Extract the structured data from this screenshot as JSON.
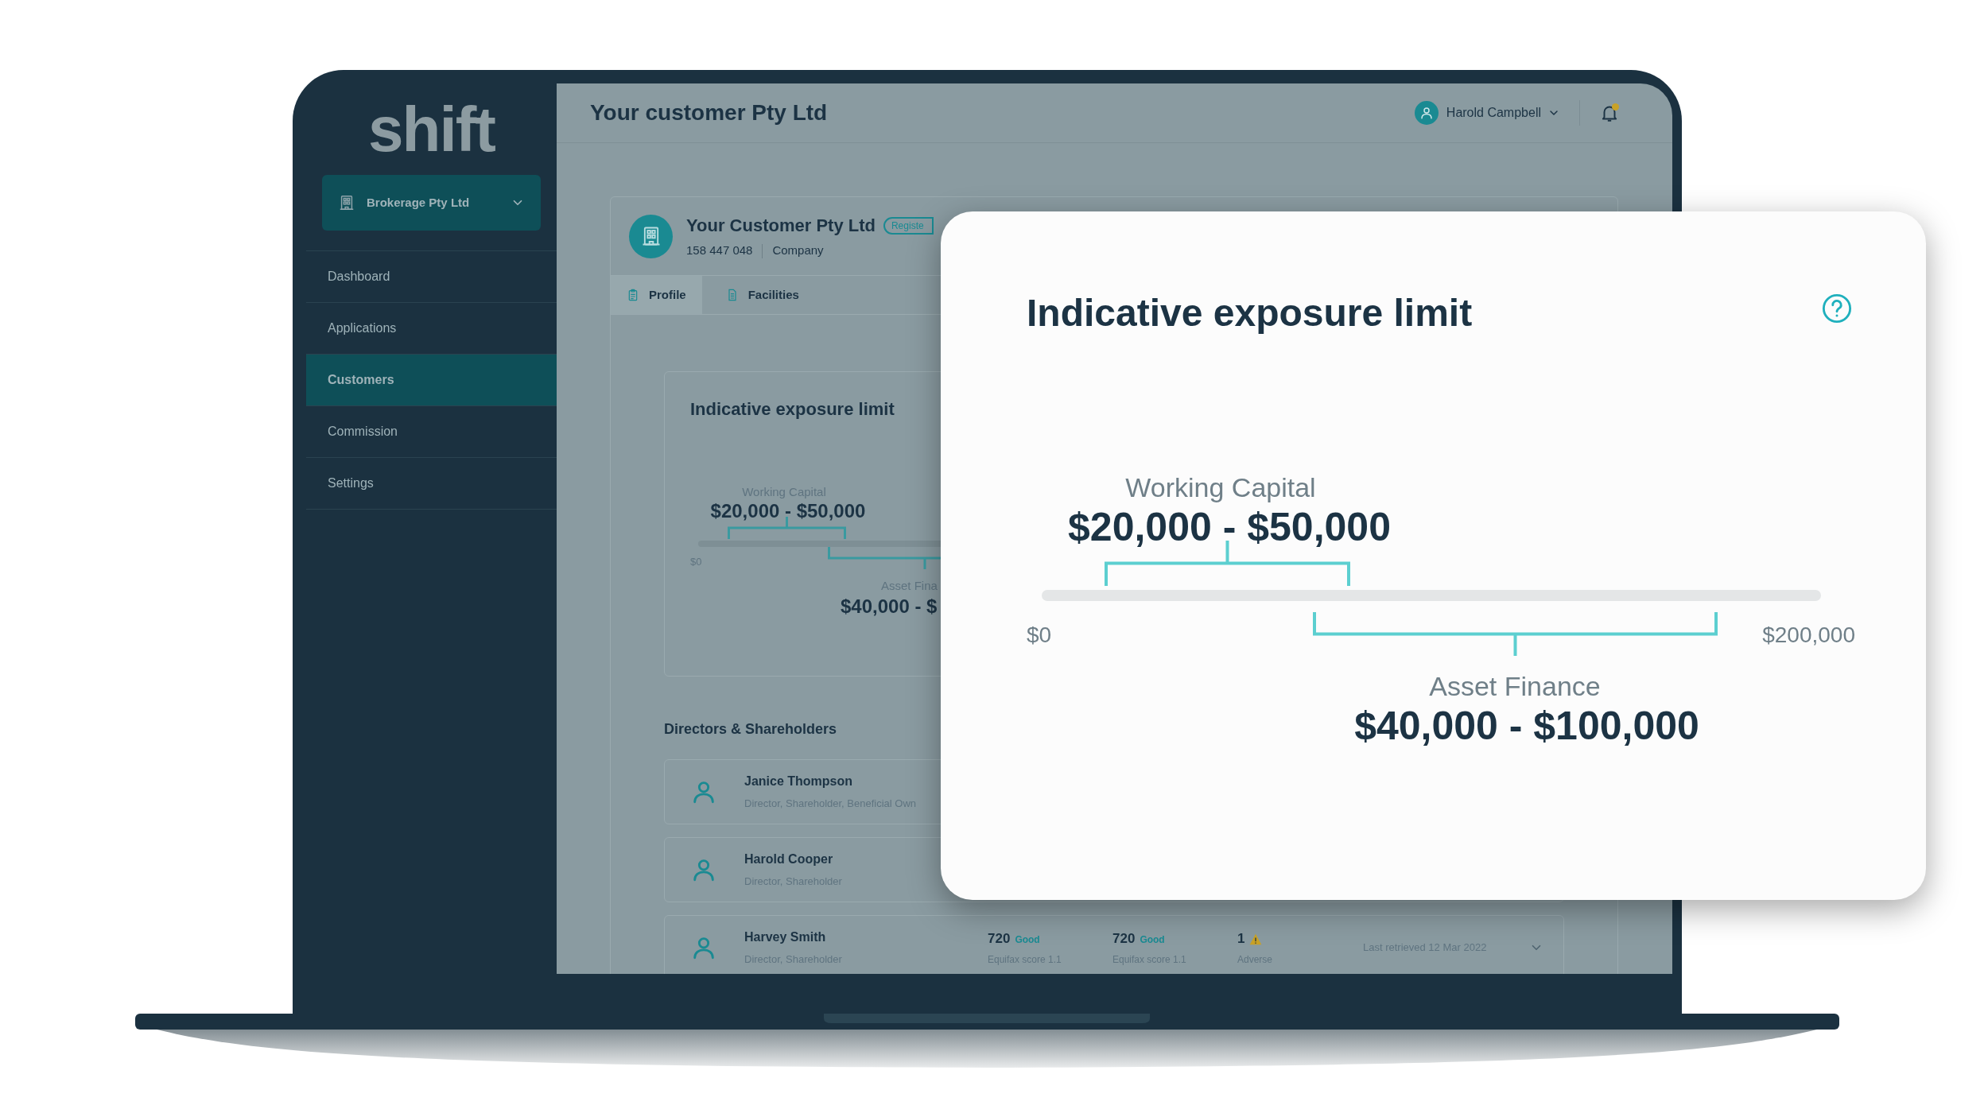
{
  "sidebar": {
    "logo": "shift",
    "account_switcher": {
      "label": "Brokerage Pty Ltd"
    },
    "items": [
      {
        "label": "Dashboard",
        "selected": false
      },
      {
        "label": "Applications",
        "selected": false
      },
      {
        "label": "Customers",
        "selected": true
      },
      {
        "label": "Commission",
        "selected": false
      },
      {
        "label": "Settings",
        "selected": false
      }
    ]
  },
  "header": {
    "title": "Your customer Pty Ltd",
    "user": "Harold Campbell",
    "unread_notifications": true
  },
  "customer": {
    "name": "Your Customer Pty Ltd",
    "badge": "Registe",
    "number": "158 447 048",
    "type": "Company",
    "tabs": [
      {
        "label": "Profile",
        "selected": true
      },
      {
        "label": "Facilities",
        "selected": false
      }
    ]
  },
  "exposure_card": {
    "title": "Indicative exposure limit",
    "axis_min": "$0",
    "ranges": [
      {
        "label": "Working Capital",
        "value": "$20,000 - $50,000"
      },
      {
        "label": "Asset Fina",
        "value": "$40,000 - $"
      }
    ]
  },
  "directors": {
    "title": "Directors & Shareholders",
    "people": [
      {
        "name": "Janice Thompson",
        "roles": "Director, Shareholder, Beneficial Own"
      },
      {
        "name": "Harold Cooper",
        "roles": "Director, Shareholder"
      },
      {
        "name": "Harvey Smith",
        "roles": "Director, Shareholder",
        "scores": [
          {
            "score": "720",
            "rating": "Good",
            "source": "Equifax score 1.1"
          },
          {
            "score": "720",
            "rating": "Good",
            "source": "Equifax score 1.1"
          }
        ],
        "adverse": {
          "count": "1",
          "label": "Adverse"
        },
        "retrieved": "Last retrieved 12 Mar 2022"
      }
    ]
  },
  "popup": {
    "title": "Indicative exposure limit",
    "axis_min": "$0",
    "axis_max": "$200,000",
    "ranges": [
      {
        "label": "Working Capital",
        "value": "$20,000 - $50,000"
      },
      {
        "label": "Asset Finance",
        "value": "$40,000 - $100,000"
      }
    ]
  }
}
